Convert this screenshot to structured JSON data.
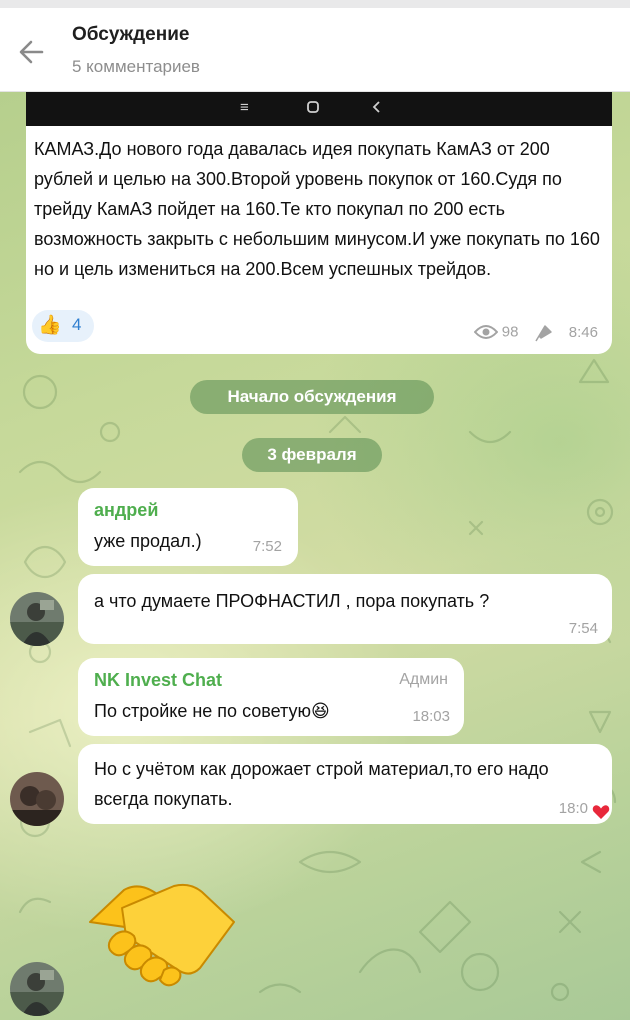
{
  "header": {
    "title": "Обсуждение",
    "subtitle": "5 комментариев",
    "back_icon": "arrow-left-icon"
  },
  "post": {
    "text": "КАМАЗ.До нового года давалась идея покупать КамАЗ от 200 рублей и целью на 300.Второй уровень покупок от 160.Судя по трейду КамАЗ пойдет на 160.Те кто покупал по 200 есть возможность закрыть с небольшим минусом.И уже покупать по 160 но и цель измениться на 200.Всем успешных трейдов.",
    "reaction_emoji": "👍",
    "reaction_count": "4",
    "views": "98",
    "time": "8:46"
  },
  "service": {
    "discussion_start": "Начало обсуждения",
    "date": "3 февраля"
  },
  "messages": [
    {
      "sender": "андрей",
      "text": "уже продал.)",
      "time": "7:52"
    },
    {
      "text": "а что думаете ПРОФНАСТИЛ , пора покупать ?",
      "time": "7:54"
    },
    {
      "sender": "NK Invest Chat",
      "role": "Админ",
      "text": "По стройке не по советую😆",
      "time": "18:03"
    },
    {
      "text": "Но с учётом как дорожает строй материал,то его надо всегда покупать.",
      "time": "18:0",
      "reaction": "❤️"
    }
  ],
  "sticker": "handshake-sticker",
  "colors": {
    "sender_green": "#4fae4e",
    "accent_blue": "#2f7fd0",
    "service_pill": "#5e9356",
    "heart_red": "#e8283b"
  }
}
